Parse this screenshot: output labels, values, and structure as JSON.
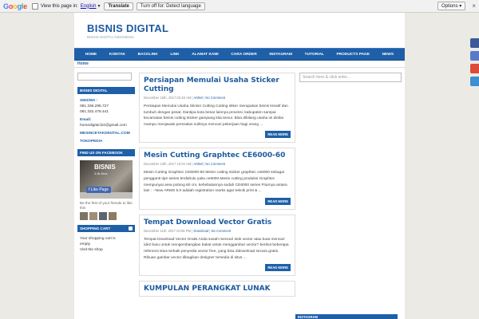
{
  "translate_bar": {
    "view_text": "View this page in:",
    "language": "English",
    "translate_label": "Translate",
    "turn_off_label": "Turn off for: Detect language",
    "options_label": "Options",
    "close_glyph": "×"
  },
  "site": {
    "title": "BISNIS DIGITAL",
    "description": "BISNIS DIGITAL INDONESIA"
  },
  "nav": [
    "HOME",
    "KONTAK",
    "BACKLINK",
    "LINK",
    "ALAMAT KAMI",
    "CARA ORDER",
    "INSTAGRAM",
    "TUTORIAL",
    "PRODUCTS PAGE",
    "NEWS"
  ],
  "breadcrumb": "Home",
  "left_sidebar": {
    "widget1_title": "BISNIS DIGITAL",
    "sms_label": "SMS/WA :",
    "phone1": "081.336.295.727",
    "phone2": "081.332.478.441",
    "email_label": "Email:",
    "email": "homedigital.biz@gmail.com",
    "store_link": "MESINCETAKDIGITAL.COM",
    "tokopedia": "TOKOPEDIA",
    "fb_title": "FIND US ON FACEBOOK",
    "fb_page_name": "BISNIS",
    "fb_likes": "3.8k likes",
    "fb_like_button": "Like Page",
    "fb_first": "Be the first of your friends to like this",
    "cart_title": "SHOPPING CART",
    "cart_line1": "Your shopping cart is",
    "cart_line2": "empty",
    "cart_line3": "Visit the shop"
  },
  "posts": [
    {
      "title": "Persiapan Memulai Usaha Sticker Cutting",
      "date": "December 15th, 2017 02:45 AM",
      "category": "Artikel",
      "comments": "No Comment",
      "excerpt": "Persiapan Memulai Usaha Sticker Cutting Cutting stiker merupakan bisnis kreatif dan tumbuh dengan pesat. Dantipa kota besar lainnya provinsi, kabupaten sampai kecamatan bisnis cutting sticker gampang kita temui. Bisa dibilang usaha ini dinilai mampu menjawab persoalan sulitnya mencari pekerjaan bagi orang ...",
      "read_more": "READ MORE"
    },
    {
      "title": "Mesin Cutting Graphtec CE6000-60",
      "date": "December 13th, 2017 10:02 AM",
      "category": "Artikel",
      "comments": "No Comment",
      "excerpt": "Mesin Cutting Graphtec CE6000-60 Mesin cutting sticker graphtec ce6000 sebagai pengganti tipe series terdahulu yaitu ce5000.Mesin cutting produksi Graphtec mempunyai area potong 60 cm, kehebatannya sudah CE6000 series Fiturnya  antara lain : --New ARMS 5.0 adalah registration marks agar teknik print & ...",
      "read_more": "READ MORE"
    },
    {
      "title": "Tempat Download Vector Gratis",
      "date": "December 11th, 2017 04:06 PM",
      "category": "Download",
      "comments": "No Comment",
      "excerpt": "Tempat Download Vector Gratis Anda susah mencari stok vector atau buat mencari ide2 baru untuk mengembangkan bakat untuk menggambar vector? berikut beberapa referensi situs terbaik penyedia vector free, yang bisa didownload secara gratis. Ribuan gambar vector dibagikan designer tersedia di situs ...",
      "read_more": "READ MORE"
    },
    {
      "title": "KUMPULAN PERANGKAT LUNAK"
    }
  ],
  "right_sidebar": {
    "search_placeholder": "Search here & click enter...",
    "bottom_title": "INSTAGRAM"
  },
  "share_colors": [
    "#3b5998",
    "#5a79c8",
    "#dd4b39",
    "#3e8ed0"
  ]
}
